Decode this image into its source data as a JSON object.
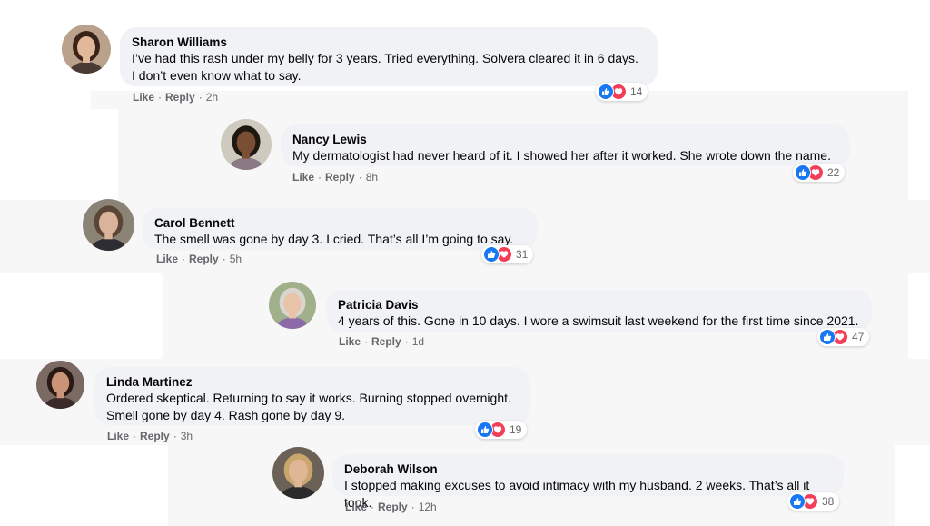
{
  "comments": [
    {
      "author": "Sharon Williams",
      "text": "I’ve had this rash under my belly for 3 years. Tried everything. Solvera cleared it in 6 days.\nI don’t even know what to say.",
      "like": "Like",
      "reply": "Reply",
      "time": "2h",
      "reactions": "14",
      "avatar": {
        "bg": "#b9a18c",
        "hair": "#3a2418",
        "skin": "#e2b89a",
        "shirt": "#4b3b35"
      }
    },
    {
      "author": "Nancy Lewis",
      "text": "My dermatologist had never heard of it. I showed her after it worked. She wrote down the name.",
      "like": "Like",
      "reply": "Reply",
      "time": "8h",
      "reactions": "22",
      "avatar": {
        "bg": "#cfcabf",
        "hair": "#1f1712",
        "skin": "#7a4d35",
        "shirt": "#8a7a86"
      }
    },
    {
      "author": "Carol Bennett",
      "text": "The smell was gone by day 3. I cried. That’s all I’m going to say.",
      "like": "Like",
      "reply": "Reply",
      "time": "5h",
      "reactions": "31",
      "avatar": {
        "bg": "#8b8375",
        "hair": "#5a4536",
        "skin": "#d9b49b",
        "shirt": "#2d2d33"
      }
    },
    {
      "author": "Patricia Davis",
      "text": "4 years of this. Gone in 10 days. I wore a swimsuit last weekend for the first time since 2021.",
      "like": "Like",
      "reply": "Reply",
      "time": "1d",
      "reactions": "47",
      "avatar": {
        "bg": "#9fb08a",
        "hair": "#d9d6d0",
        "skin": "#e8c3a8",
        "shirt": "#8c6aa8"
      }
    },
    {
      "author": "Linda Martinez",
      "text": "Ordered skeptical. Returning to say it works. Burning stopped overnight.\nSmell gone by day 4. Rash gone by day 9.",
      "like": "Like",
      "reply": "Reply",
      "time": "3h",
      "reactions": "19",
      "avatar": {
        "bg": "#7a6a63",
        "hair": "#2a1a14",
        "skin": "#c99478",
        "shirt": "#3a2a2a"
      }
    },
    {
      "author": "Deborah Wilson",
      "text": "I stopped making excuses to avoid intimacy with my husband. 2 weeks. That’s all it took.",
      "like": "Like",
      "reply": "Reply",
      "time": "12h",
      "reactions": "38",
      "avatar": {
        "bg": "#6b6157",
        "hair": "#c9a66b",
        "skin": "#e0b796",
        "shirt": "#2b2b2b"
      }
    }
  ],
  "colors": {
    "like": "#1877f2",
    "love": "#f33e58",
    "bubble": "#f0f2f5",
    "meta": "#65676b"
  },
  "icons": {
    "like": "thumbs-up-icon",
    "love": "heart-icon"
  }
}
